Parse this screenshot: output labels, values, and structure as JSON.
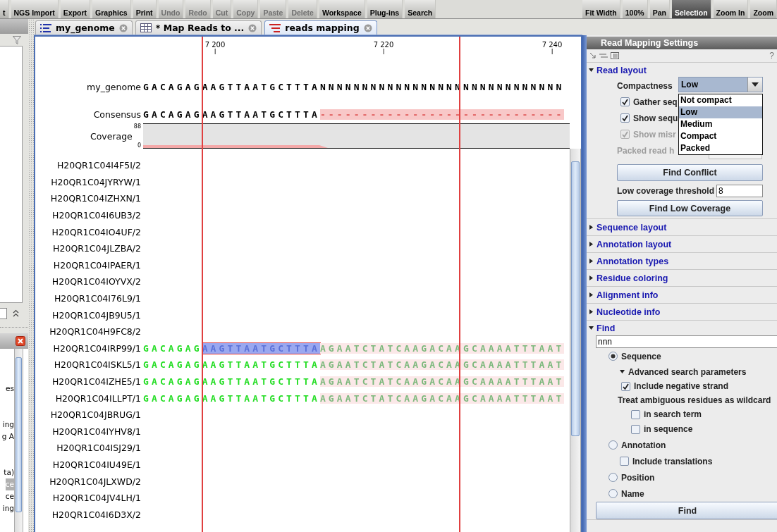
{
  "toolbar": {
    "left": [
      {
        "label": "t",
        "disabled": false
      },
      {
        "label": "NGS Import",
        "disabled": false
      },
      {
        "label": "Export",
        "disabled": false
      },
      {
        "label": "Graphics",
        "disabled": false
      },
      {
        "label": "Print",
        "disabled": false
      },
      {
        "label": "Undo",
        "disabled": true
      },
      {
        "label": "Redo",
        "disabled": true
      },
      {
        "label": "Cut",
        "disabled": true
      },
      {
        "label": "Copy",
        "disabled": true
      },
      {
        "label": "Paste",
        "disabled": true
      },
      {
        "label": "Delete",
        "disabled": true
      },
      {
        "label": "Workspace",
        "disabled": false
      },
      {
        "label": "Plug-ins",
        "disabled": false
      },
      {
        "label": "Search",
        "disabled": false
      }
    ],
    "right": [
      {
        "label": "Fit Width",
        "selected": false
      },
      {
        "label": "100%",
        "selected": false
      },
      {
        "label": "Pan",
        "selected": false
      },
      {
        "label": "Selection",
        "selected": true
      },
      {
        "label": "Zoom In",
        "selected": false
      },
      {
        "label": "Zoom",
        "selected": false
      }
    ]
  },
  "navigation": {
    "items": [
      {
        "text": "es",
        "selected": false
      },
      {
        "text": "ing",
        "selected": false
      },
      {
        "text": "g A",
        "selected": false
      },
      {
        "text": "ta)",
        "selected": false
      },
      {
        "text": "ce",
        "selected": true
      },
      {
        "text": "ce",
        "selected": false
      },
      {
        "text": "ing",
        "selected": false
      }
    ]
  },
  "tabs": [
    {
      "label": "my_genome",
      "kind": "sequence",
      "selected": false
    },
    {
      "label": "* Map Reads to ...",
      "kind": "table",
      "selected": false
    },
    {
      "label": "reads mapping",
      "kind": "mapping",
      "selected": true
    }
  ],
  "viewer": {
    "ruler": [
      "7 200",
      "7 220",
      "7 240"
    ],
    "genome": {
      "label": "my_genome",
      "bases": "GACAGAGAAGTTAATGCTTTANNNNNNNNNNNNNNNNNNNNNNNNNNNNN"
    },
    "consensus": {
      "label": "Consensus",
      "bases": "GACAGAGAAGTTAATGCTTTA",
      "gaps": "-----------------------------"
    },
    "coverage": {
      "label": "Coverage",
      "max": "88",
      "min": "0"
    },
    "reads": [
      {
        "name": "H20QR1C04I4F5I/2"
      },
      {
        "name": "H20QR1C04JYRYW/1"
      },
      {
        "name": "H20QR1C04IZHXN/1"
      },
      {
        "name": "H20QR1C04I6UB3/2"
      },
      {
        "name": "H20QR1C04IO4UF/2"
      },
      {
        "name": "H20QR1C04JLZBA/2"
      },
      {
        "name": "H20QR1C04IPAER/1"
      },
      {
        "name": "H20QR1C04IOYVX/2"
      },
      {
        "name": "H20QR1C04I76L9/1"
      },
      {
        "name": "H20QR1C04JB9U5/1"
      },
      {
        "name": "H20QR1C04H9FC8/2"
      },
      {
        "name": "H20QR1C04IRP99/1",
        "alignment": {
          "selected": true,
          "start": "GACAGAG",
          "middle": "AAGTTAATGCTTTA",
          "clipped": "AGAATCTATCAAGACAAGCAAAATTTAAT"
        }
      },
      {
        "name": "H20QR1C04ISKL5/1",
        "alignment": {
          "selected": false,
          "start": "GACAGAG",
          "middle": "AAGTTAATGCTTTA",
          "clipped": "AGAATCTATCAAGACAAGCAAAATTTAAT"
        }
      },
      {
        "name": "H20QR1C04IZHE5/1",
        "alignment": {
          "selected": false,
          "start": "GACAGAG",
          "middle": "AAGTTAATGCTTTA",
          "clipped": "AGAATCTATCAAGACAAGCAAAATTTAAT"
        }
      },
      {
        "name": "H20QR1C04ILLPT/1",
        "alignment": {
          "selected": false,
          "start": "GACAGAG",
          "middle": "AAGTTAATGCTTTA",
          "clipped": "AGAATCTATCAAGACAAGCAAAATTTAAT"
        }
      },
      {
        "name": "H20QR1C04JBRUG/1"
      },
      {
        "name": "H20QR1C04IYHV8/1"
      },
      {
        "name": "H20QR1C04ISJ29/1"
      },
      {
        "name": "H20QR1C04IU49E/1"
      },
      {
        "name": "H20QR1C04JLXWD/2"
      },
      {
        "name": "H20QR1C04JV4LH/1"
      },
      {
        "name": "H20QR1C04I6D3X/2"
      }
    ]
  },
  "settings": {
    "title": "Read Mapping Settings",
    "help": "?",
    "sections": [
      {
        "title": "Read layout",
        "expanded": true,
        "kind": "read_layout"
      },
      {
        "title": "Sequence layout",
        "expanded": false
      },
      {
        "title": "Annotation layout",
        "expanded": false
      },
      {
        "title": "Annotation types",
        "expanded": false
      },
      {
        "title": "Residue coloring",
        "expanded": false
      },
      {
        "title": "Alignment info",
        "expanded": false
      },
      {
        "title": "Nucleotide info",
        "expanded": false
      },
      {
        "title": "Find",
        "expanded": true,
        "kind": "find"
      }
    ],
    "read_layout": {
      "compactness": {
        "label": "Compactness",
        "value": "Low",
        "options": [
          {
            "label": "Not compact",
            "selected": false
          },
          {
            "label": "Low",
            "selected": true
          },
          {
            "label": "Medium",
            "selected": false
          },
          {
            "label": "Compact",
            "selected": false
          },
          {
            "label": "Packed",
            "selected": false
          }
        ]
      },
      "checkboxes": [
        {
          "label": "Gather seq",
          "checked": true,
          "disabled": false
        },
        {
          "label": "Show sequ",
          "checked": true,
          "disabled": false
        },
        {
          "label": "Show misr",
          "checked": true,
          "disabled": true
        }
      ],
      "packed_height": {
        "label": "Packed read h",
        "disabled": true
      },
      "conflict_button": "Find Conflict",
      "threshold": {
        "label": "Low coverage threshold",
        "value": "8"
      },
      "low_coverage_button": "Find Low Coverage"
    },
    "find": {
      "value": "nnn",
      "types": [
        {
          "label": "Sequence",
          "selected": true
        },
        {
          "label": "Annotation",
          "selected": false
        },
        {
          "label": "Position",
          "selected": false
        },
        {
          "label": "Name",
          "selected": false
        }
      ],
      "advanced": {
        "title": "Advanced search parameters",
        "expanded": true,
        "negative_strand": {
          "label": "Include negative strand",
          "checked": true
        },
        "wildcard_title": "Treat ambiguous residues as wildcard",
        "wildcard": [
          {
            "label": "in search term",
            "checked": false
          },
          {
            "label": "in sequence",
            "checked": false
          }
        ]
      },
      "translations": {
        "label": "Include translations",
        "checked": false
      },
      "button": "Find"
    }
  }
}
